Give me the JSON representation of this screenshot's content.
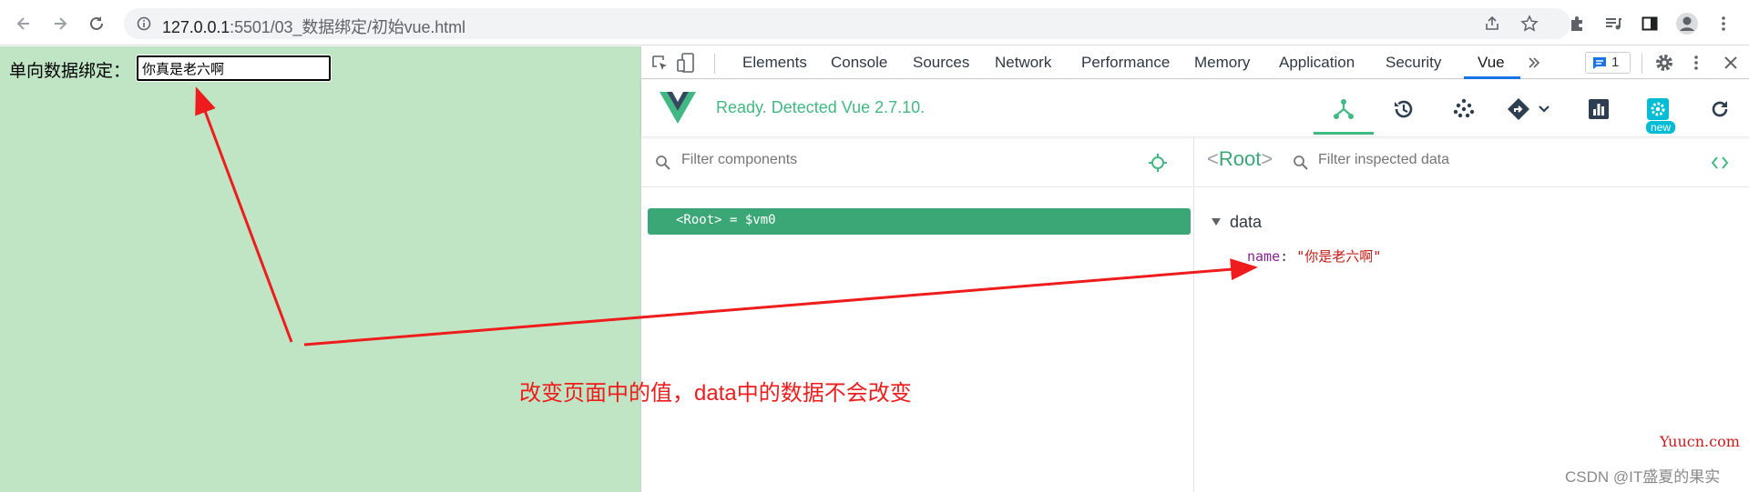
{
  "browser": {
    "url_host": "127.0.0.1",
    "url_rest": ":5501/03_数据绑定/初始vue.html"
  },
  "page": {
    "label": "单向数据绑定：",
    "input_value": "你真是老六啊"
  },
  "devtools": {
    "tabs": [
      "Elements",
      "Console",
      "Sources",
      "Network",
      "Performance",
      "Memory",
      "Application",
      "Security",
      "Vue"
    ],
    "active_tab": "Vue",
    "issues_count": "1",
    "vue_status": "Ready. Detected Vue 2.7.10.",
    "new_badge": "new",
    "components_filter_placeholder": "Filter components",
    "root_row": "<Root> = $vm0",
    "inspector_title": "Root",
    "inspector_filter_placeholder": "Filter inspected data",
    "data_section": "data",
    "data_key": "name",
    "data_value": "\"你是老六啊\""
  },
  "annotation": {
    "text": "改变页面中的值，data中的数据不会改变",
    "color": "#ee1c1c"
  },
  "watermarks": {
    "site": "Yuucn.com",
    "author": "CSDN @IT盛夏的果实"
  },
  "colors": {
    "vue_green": "#42b883",
    "page_bg": "#c0e5c4",
    "devtools_accent": "#1a73e8"
  }
}
